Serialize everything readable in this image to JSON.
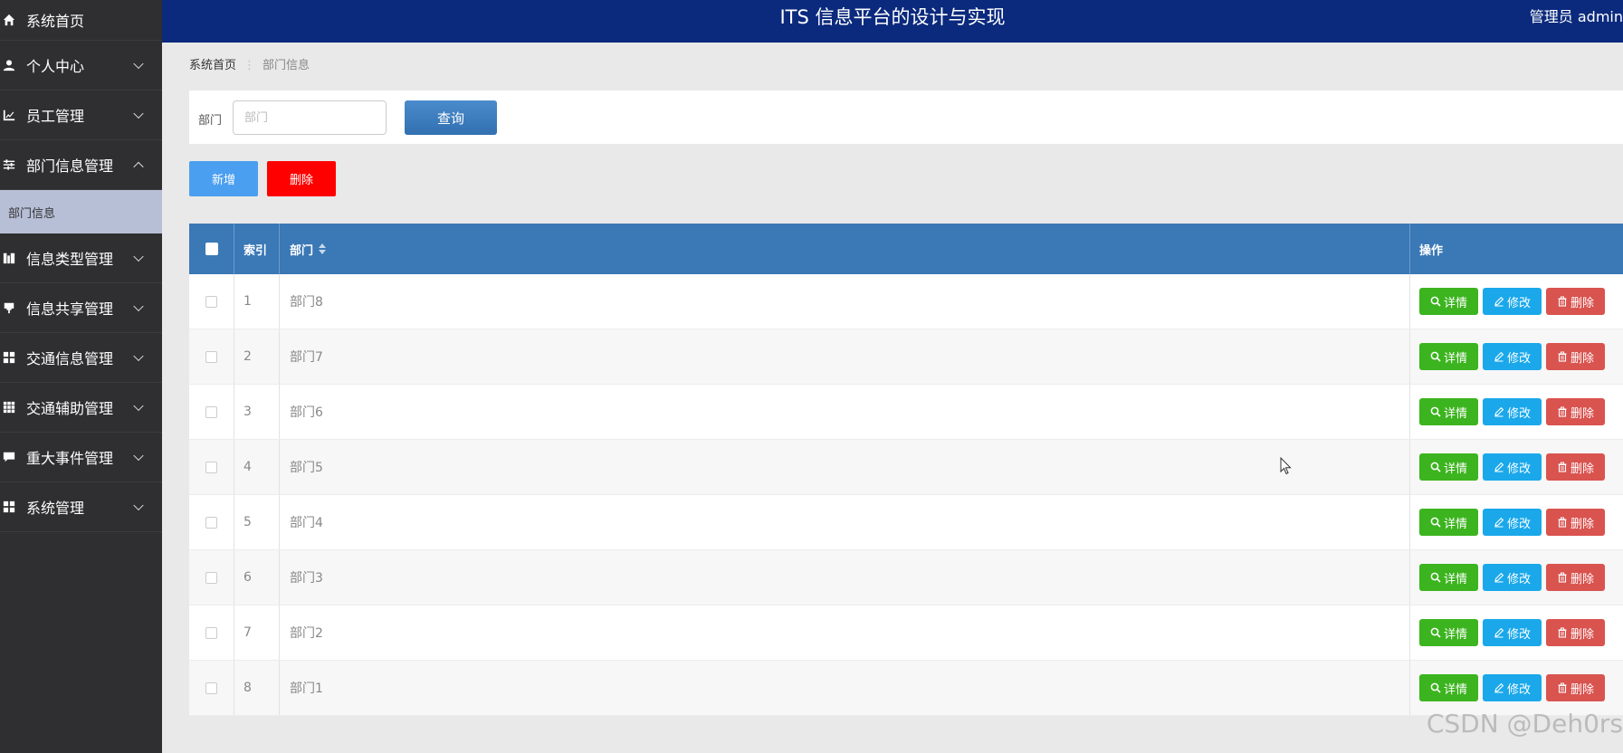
{
  "sidebar": {
    "items": [
      {
        "label": "系统首页",
        "icon": "home-icon"
      },
      {
        "label": "个人中心",
        "icon": "user-icon"
      },
      {
        "label": "员工管理",
        "icon": "chart-icon"
      },
      {
        "label": "部门信息管理",
        "icon": "sliders-icon",
        "expanded": true
      },
      {
        "label": "信息类型管理",
        "icon": "bars-icon"
      },
      {
        "label": "信息共享管理",
        "icon": "pin-icon"
      },
      {
        "label": "交通信息管理",
        "icon": "grid-icon"
      },
      {
        "label": "交通辅助管理",
        "icon": "grid-small-icon"
      },
      {
        "label": "重大事件管理",
        "icon": "comment-icon"
      },
      {
        "label": "系统管理",
        "icon": "grid-icon"
      }
    ],
    "sub_item": "部门信息"
  },
  "header": {
    "title": "ITS 信息平台的设计与实现",
    "user": "管理员 admin"
  },
  "breadcrumb": {
    "home": "系统首页",
    "sep": "⋮",
    "current": "部门信息"
  },
  "search": {
    "label": "部门",
    "placeholder": "部门",
    "button": "查询"
  },
  "actions": {
    "add": "新增",
    "delete": "删除"
  },
  "table": {
    "headers": {
      "index": "索引",
      "dept": "部门",
      "ops": "操作"
    },
    "rows": [
      {
        "index": "1",
        "dept": "部门8"
      },
      {
        "index": "2",
        "dept": "部门7"
      },
      {
        "index": "3",
        "dept": "部门6"
      },
      {
        "index": "4",
        "dept": "部门5"
      },
      {
        "index": "5",
        "dept": "部门4"
      },
      {
        "index": "6",
        "dept": "部门3"
      },
      {
        "index": "7",
        "dept": "部门2"
      },
      {
        "index": "8",
        "dept": "部门1"
      }
    ],
    "ops": {
      "detail": "详情",
      "edit": "修改",
      "delete": "删除"
    }
  },
  "watermark": "CSDN @Deh0rs",
  "colors": {
    "sidebar": "#2f2f31",
    "header": "#0b2a7d",
    "table_header": "#3a78b6",
    "detail": "#3cb41f",
    "edit": "#1aa8ea",
    "delete": "#d9534f",
    "danger": "#ff0000",
    "primary": "#4a9ff0"
  }
}
